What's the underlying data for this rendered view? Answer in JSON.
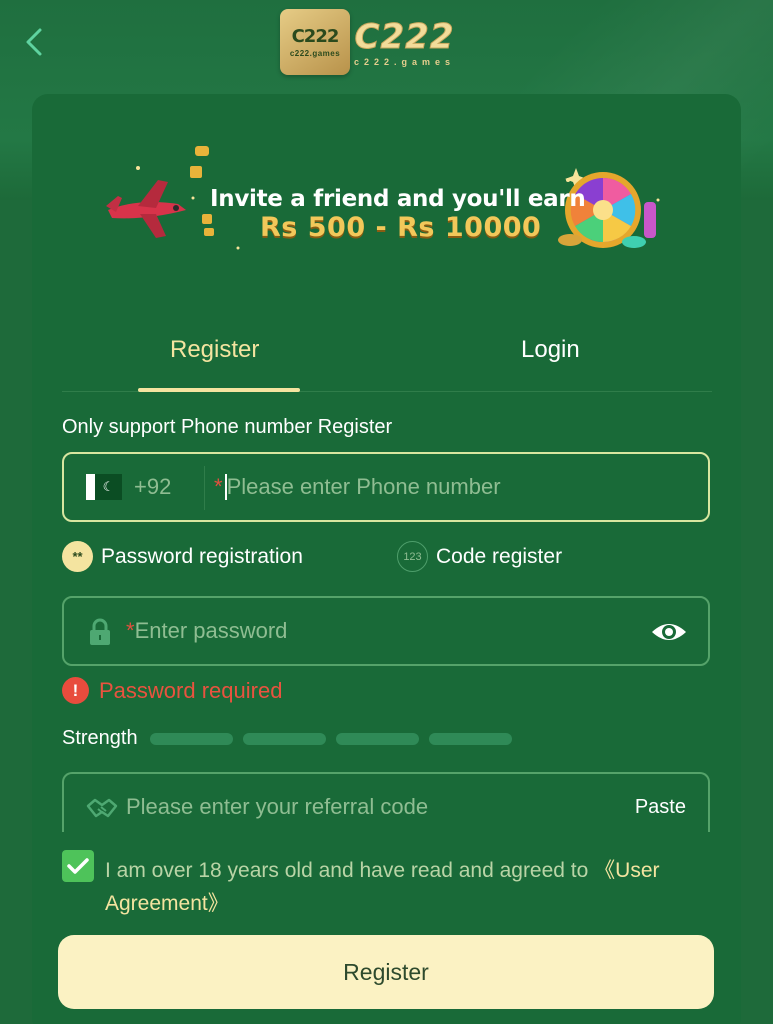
{
  "header": {
    "logo_badge_text": "C222",
    "logo_badge_sub": "c222.games",
    "logo_main": "C222",
    "logo_sub": "c222.games"
  },
  "banner": {
    "title": "Invite a friend and you'll earn",
    "amount": "Rs 500 - Rs 10000"
  },
  "tabs": [
    {
      "label": "Register",
      "active": true
    },
    {
      "label": "Login",
      "active": false
    }
  ],
  "form": {
    "hint": "Only support Phone number Register",
    "phone": {
      "dial_code": "+92",
      "required_mark": "*",
      "placeholder": "Please enter Phone number"
    },
    "modes": [
      {
        "label": "Password registration",
        "icon": "asterisks-icon",
        "selected": true,
        "icon_text": "**"
      },
      {
        "label": "Code register",
        "icon": "number-123-icon",
        "selected": false,
        "icon_text": "123"
      }
    ],
    "password": {
      "required_mark": "*",
      "placeholder": "Enter password"
    },
    "error": "Password required",
    "strength": {
      "label": "Strength",
      "level": 0,
      "segments": 4
    },
    "referral": {
      "placeholder": "Please enter your referral code",
      "paste_label": "Paste"
    },
    "agreement": {
      "checked": true,
      "text": "I am over 18 years old and have read and agreed to ",
      "link": "《User Agreement》"
    },
    "submit_label": "Register"
  },
  "colors": {
    "background": "#1e6a3a",
    "card": "#196a38",
    "accent": "#f4e4a0",
    "error": "#e9533f",
    "button": "#fbf2c3",
    "checkbox": "#4ec35a"
  }
}
